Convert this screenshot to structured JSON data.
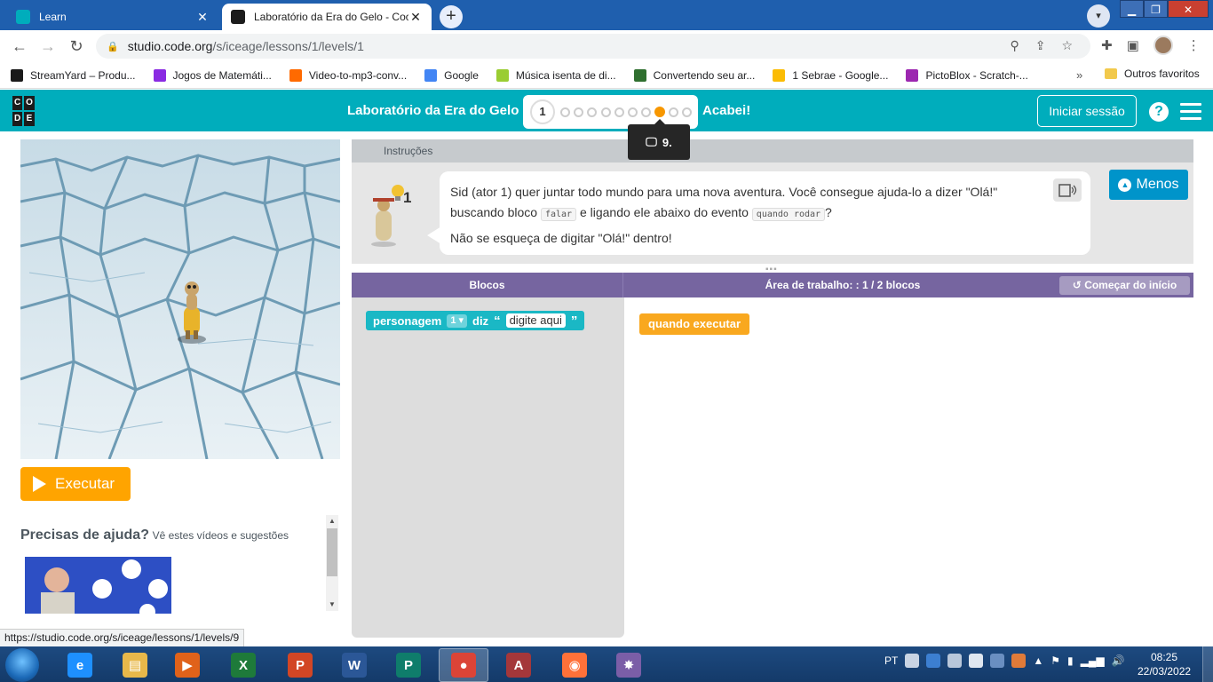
{
  "browser": {
    "tabs": [
      {
        "title": "Learn",
        "active": false
      },
      {
        "title": "Laboratório da Era do Gelo - Coc",
        "active": true
      }
    ],
    "new_tab": "+",
    "url": {
      "host": "studio.code.org",
      "path": "/s/iceage/lessons/1/levels/1"
    },
    "bookmarks": [
      {
        "label": "StreamYard – Produ...",
        "color": "#1a1a1a"
      },
      {
        "label": "Jogos de Matemáti...",
        "color": "#8a2be2"
      },
      {
        "label": "Video-to-mp3-conv...",
        "color": "#ff6a00"
      },
      {
        "label": "Google",
        "color": "#4285f4"
      },
      {
        "label": "Música isenta de di...",
        "color": "#9acd32"
      },
      {
        "label": "Convertendo seu ar...",
        "color": "#2f6f2f"
      },
      {
        "label": "1 Sebrae - Google...",
        "color": "#fbbc04"
      },
      {
        "label": "PictoBlox - Scratch-...",
        "color": "#9c27b0"
      }
    ],
    "bookmarks_more": "»",
    "other_favorites": "Outros favoritos",
    "status_url": "https://studio.code.org/s/iceage/lessons/1/levels/9"
  },
  "header": {
    "lesson_title": "Laboratório da Era do Gelo",
    "current_level": "1",
    "progress_dots": 10,
    "highlighted_dot": 8,
    "done_label": "Acabei!",
    "signin_label": "Iniciar sessão",
    "help_label": "?",
    "tooltip_label": "9."
  },
  "left": {
    "run_label": "Executar",
    "help_title": "Precisas de ajuda?",
    "help_subtitle": "Vê estes vídeos e sugestões"
  },
  "instructions": {
    "header": "Instruções",
    "hint_count": "1",
    "text_part1": "Sid (ator 1) quer juntar todo mundo para uma nova aventura. Você consegue ajuda-lo a dizer \"Olá!\" buscando bloco ",
    "chip1": "falar",
    "text_part2": " e ligando ele abaixo do evento ",
    "chip2": "quando rodar",
    "text_part3": "?",
    "text_line2": "Não se esqueça de digitar \"Olá!\" dentro!",
    "less_label": "Menos"
  },
  "workspace": {
    "blocks_label": "Blocos",
    "area_label": "Área de trabalho: : 1 / 2 blocos",
    "restart_label": "Começar do início",
    "block_say": {
      "actor": "personagem",
      "actor_value": "1 ▾",
      "verb": "diz",
      "open_quote": "“",
      "text": "digite aqui",
      "close_quote": "”"
    },
    "block_when": "quando executar"
  },
  "taskbar": {
    "apps": [
      {
        "name": "internet-explorer",
        "glyph": "e",
        "color": "#1e90ff"
      },
      {
        "name": "file-explorer",
        "glyph": "▤",
        "color": "#e8b84a"
      },
      {
        "name": "media-player",
        "glyph": "▶",
        "color": "#e0621a"
      },
      {
        "name": "excel",
        "glyph": "X",
        "color": "#1e7a3a"
      },
      {
        "name": "powerpoint",
        "glyph": "P",
        "color": "#d24625"
      },
      {
        "name": "word",
        "glyph": "W",
        "color": "#2b5797"
      },
      {
        "name": "publisher",
        "glyph": "P",
        "color": "#0f7d6b"
      },
      {
        "name": "chrome",
        "glyph": "●",
        "color": "#db4437"
      },
      {
        "name": "access",
        "glyph": "A",
        "color": "#a4373a"
      },
      {
        "name": "firefox",
        "glyph": "◉",
        "color": "#ff7139"
      },
      {
        "name": "paint-app",
        "glyph": "✸",
        "color": "#7b5ea7"
      }
    ],
    "language": "PT",
    "time": "08:25",
    "date": "22/03/2022"
  }
}
